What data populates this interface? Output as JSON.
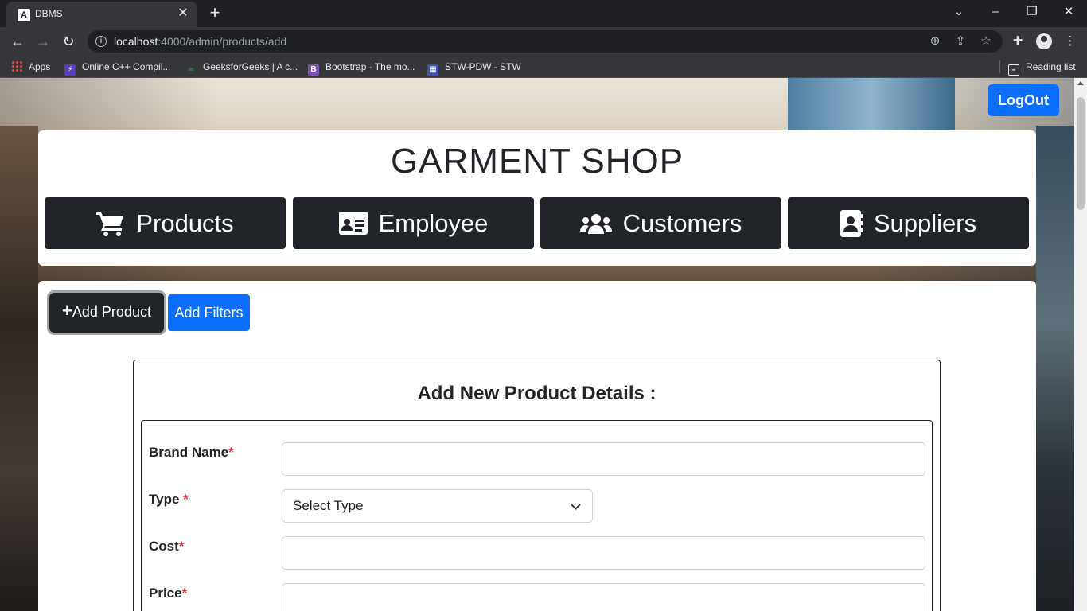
{
  "browser": {
    "tab_title": "DBMS",
    "tab_favicon": "A",
    "url_host": "localhost",
    "url_path": ":4000/admin/products/add",
    "bookmarks": [
      {
        "label": "Apps",
        "icon": "apps-grid-icon"
      },
      {
        "label": "Online C++ Compil...",
        "icon": "lightning-icon",
        "color": "#5b3fb4"
      },
      {
        "label": "GeeksforGeeks | A c...",
        "icon": "gfg-icon",
        "color": "#2f8d46"
      },
      {
        "label": "Bootstrap · The mo...",
        "icon": "bootstrap-icon",
        "color": "#7952b3"
      },
      {
        "label": "STW-PDW - STW",
        "icon": "calendar-icon",
        "color": "#3f51b5"
      }
    ],
    "reading_list": "Reading list"
  },
  "page": {
    "logout_label": "LogOut",
    "shop_title": "GARMENT SHOP",
    "nav": [
      {
        "label": "Products",
        "icon": "cart-icon"
      },
      {
        "label": "Employee",
        "icon": "id-card-icon"
      },
      {
        "label": "Customers",
        "icon": "users-icon"
      },
      {
        "label": "Suppliers",
        "icon": "address-book-icon"
      }
    ],
    "actions": {
      "add_product": "Add Product",
      "add_filters": "Add Filters"
    },
    "form": {
      "title": "Add New Product Details :",
      "required_mark": "*",
      "fields": [
        {
          "label": "Brand Name",
          "value": ""
        },
        {
          "label": "Type ",
          "selected": "Select Type"
        },
        {
          "label": "Cost",
          "value": ""
        },
        {
          "label": "Price",
          "value": ""
        }
      ]
    },
    "colors": {
      "primary": "#0d6efd",
      "dark": "#212529",
      "required": "#dc3545"
    }
  }
}
